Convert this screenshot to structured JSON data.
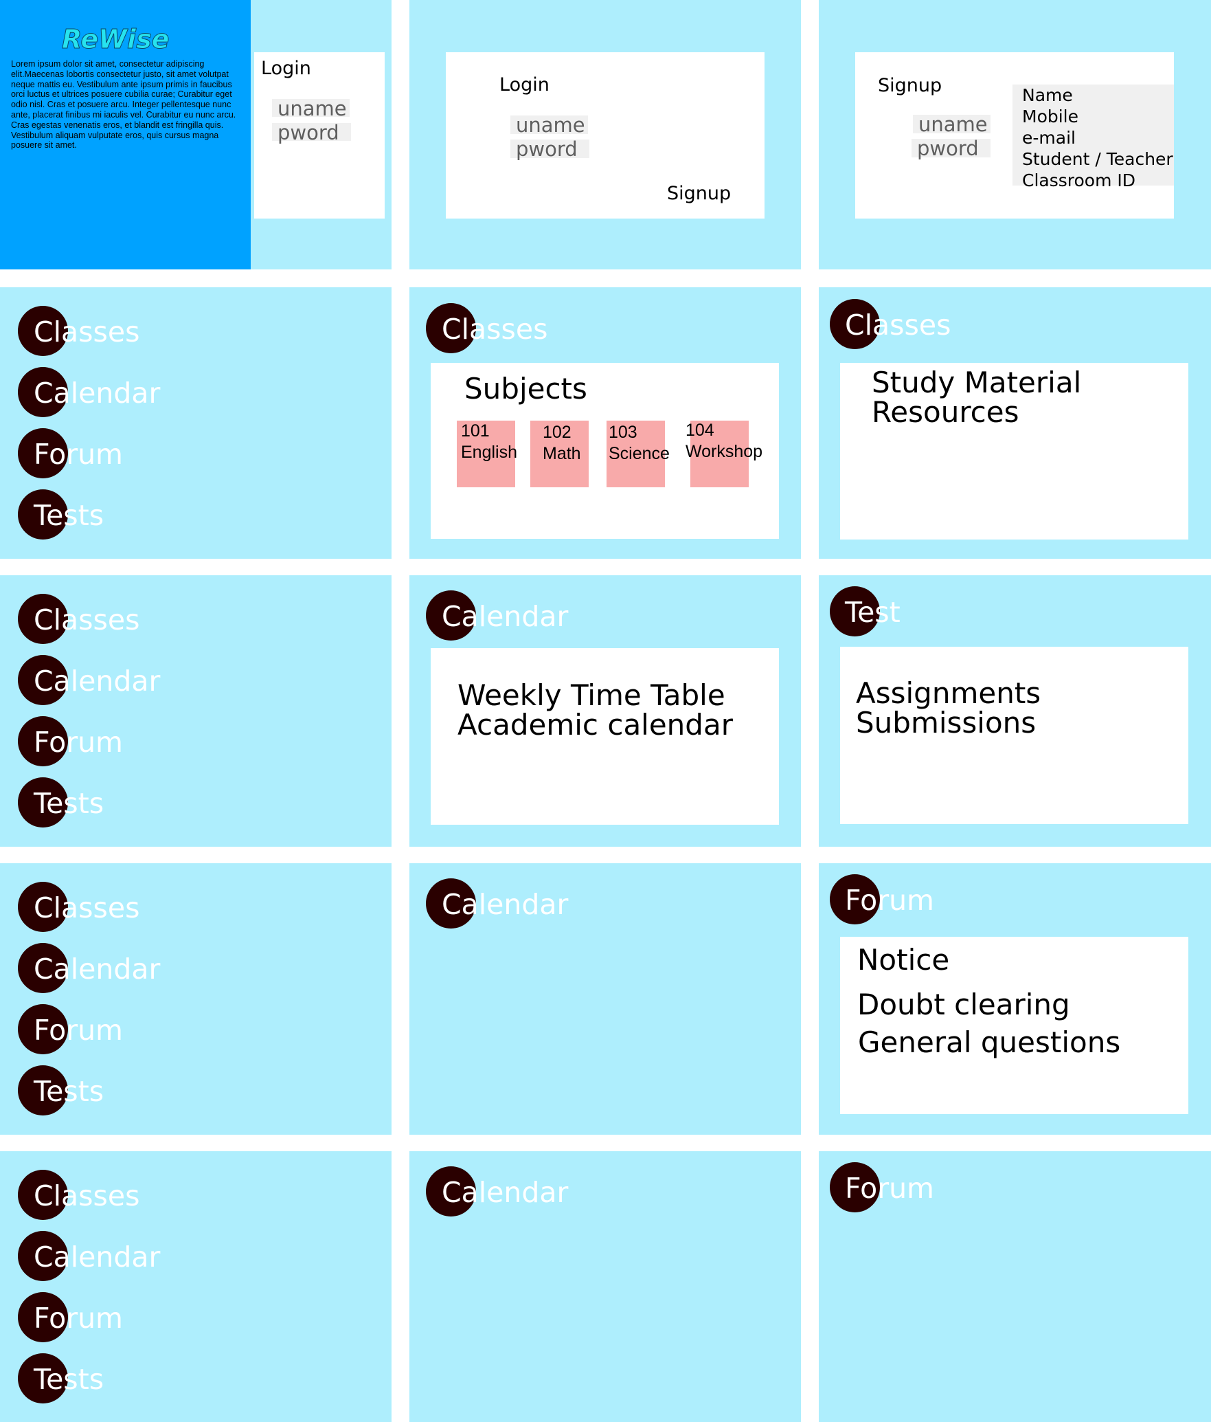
{
  "brand": {
    "logo": "ReWise",
    "description": "Lorem ipsum dolor sit amet, consectetur adipiscing elit.Maecenas lobortis consectetur justo, sit amet volutpat neque mattis eu. Vestibulum ante ipsum primis in faucibus orci luctus et ultrices posuere cubilia curae; Curabitur eget odio nisl. Cras et posuere arcu. Integer pellentesque nunc ante, placerat finibus mi iaculis vel. Curabitur eu nunc arcu. Cras egestas venenatis eros, et blandit est fringilla quis. Vestibulum aliquam vulputate eros, quis cursus magna posuere sit amet."
  },
  "login": {
    "title": "Login",
    "username_placeholder": "uname",
    "password_placeholder": "pword",
    "signup_link": "Signup"
  },
  "signup": {
    "title": "Signup",
    "username_placeholder": "uname",
    "password_placeholder": "pword",
    "fields": [
      "Name",
      "Mobile",
      "e-mail",
      "Student / Teacher",
      "Classroom ID"
    ]
  },
  "nav": {
    "classes": "Classes",
    "calendar": "Calendar",
    "forum": "Forum",
    "tests": "Tests",
    "test": "Test"
  },
  "classes": {
    "subjects_title": "Subjects",
    "subjects": [
      {
        "code": "101",
        "name": "English"
      },
      {
        "code": "102",
        "name": "Math"
      },
      {
        "code": "103",
        "name": "Science"
      },
      {
        "code": "104",
        "name": "Workshop"
      }
    ],
    "material_line1": "Study Material",
    "material_line2": "Resources"
  },
  "calendar": {
    "line1": "Weekly Time Table",
    "line2": "Academic calendar"
  },
  "test": {
    "line1": "Assignments",
    "line2": "Submissions"
  },
  "forum": {
    "notice": "Notice",
    "doubt": "Doubt clearing",
    "general": "General questions"
  },
  "colors": {
    "panel": "#aeeefd",
    "brand_block": "#00a2ff",
    "nav_circle": "#2a0000",
    "subject_tile": "#f8aaaa"
  }
}
